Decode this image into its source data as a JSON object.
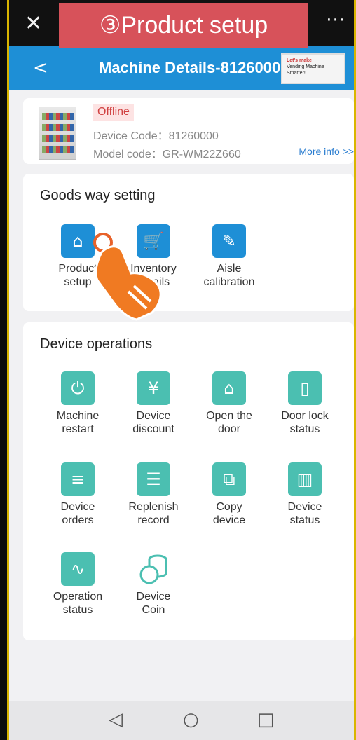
{
  "topbar": {
    "close_icon": "close-icon",
    "more_label": "···"
  },
  "banner": {
    "text": "③Product setup"
  },
  "header": {
    "back_label": "<",
    "title": "Machine Details-81260000",
    "ad": {
      "line1": "Let's make",
      "line2": "Vending Machine Smarter!"
    }
  },
  "device": {
    "status": "Offline",
    "device_code": "Device Code：81260000",
    "model_code": "Model code：GR-WM22Z660",
    "more_info": "More info >>"
  },
  "goods_section": {
    "title": "Goods way setting",
    "items": [
      {
        "label": "Product\nsetup",
        "icon": "product-setup-icon",
        "glyph": "⌂"
      },
      {
        "label": "Inventory\ndetails",
        "icon": "cart-icon",
        "glyph": "🛒"
      },
      {
        "label": "Aisle\ncalibration",
        "icon": "edit-icon",
        "glyph": "✎"
      }
    ]
  },
  "ops_section": {
    "title": "Device operations",
    "items": [
      {
        "label": "Machine\nrestart",
        "icon": "power-icon",
        "glyph": "⏻"
      },
      {
        "label": "Device\ndiscount",
        "icon": "discount-icon",
        "glyph": "¥"
      },
      {
        "label": "Open the\ndoor",
        "icon": "house-key-icon",
        "glyph": "⌂"
      },
      {
        "label": "Door lock\nstatus",
        "icon": "door-icon",
        "glyph": "▯"
      },
      {
        "label": "Device\norders",
        "icon": "receipt-icon",
        "glyph": "≡"
      },
      {
        "label": "Replenish\nrecord",
        "icon": "record-icon",
        "glyph": "☰"
      },
      {
        "label": "Copy\ndevice",
        "icon": "copy-icon",
        "glyph": "⧉"
      },
      {
        "label": "Device\nstatus",
        "icon": "book-icon",
        "glyph": "▥"
      },
      {
        "label": "Operation\nstatus",
        "icon": "wave-icon",
        "glyph": "∿"
      },
      {
        "label": "Device\nCoin",
        "icon": "coin-icon",
        "glyph": "◎"
      }
    ]
  },
  "navbar": {
    "back": "◁",
    "home": "○",
    "recent": "□"
  },
  "colors": {
    "header": "#1e8fd6",
    "teal": "#4bbfb1",
    "offline": "#d04040",
    "banner": "#d7525a"
  }
}
